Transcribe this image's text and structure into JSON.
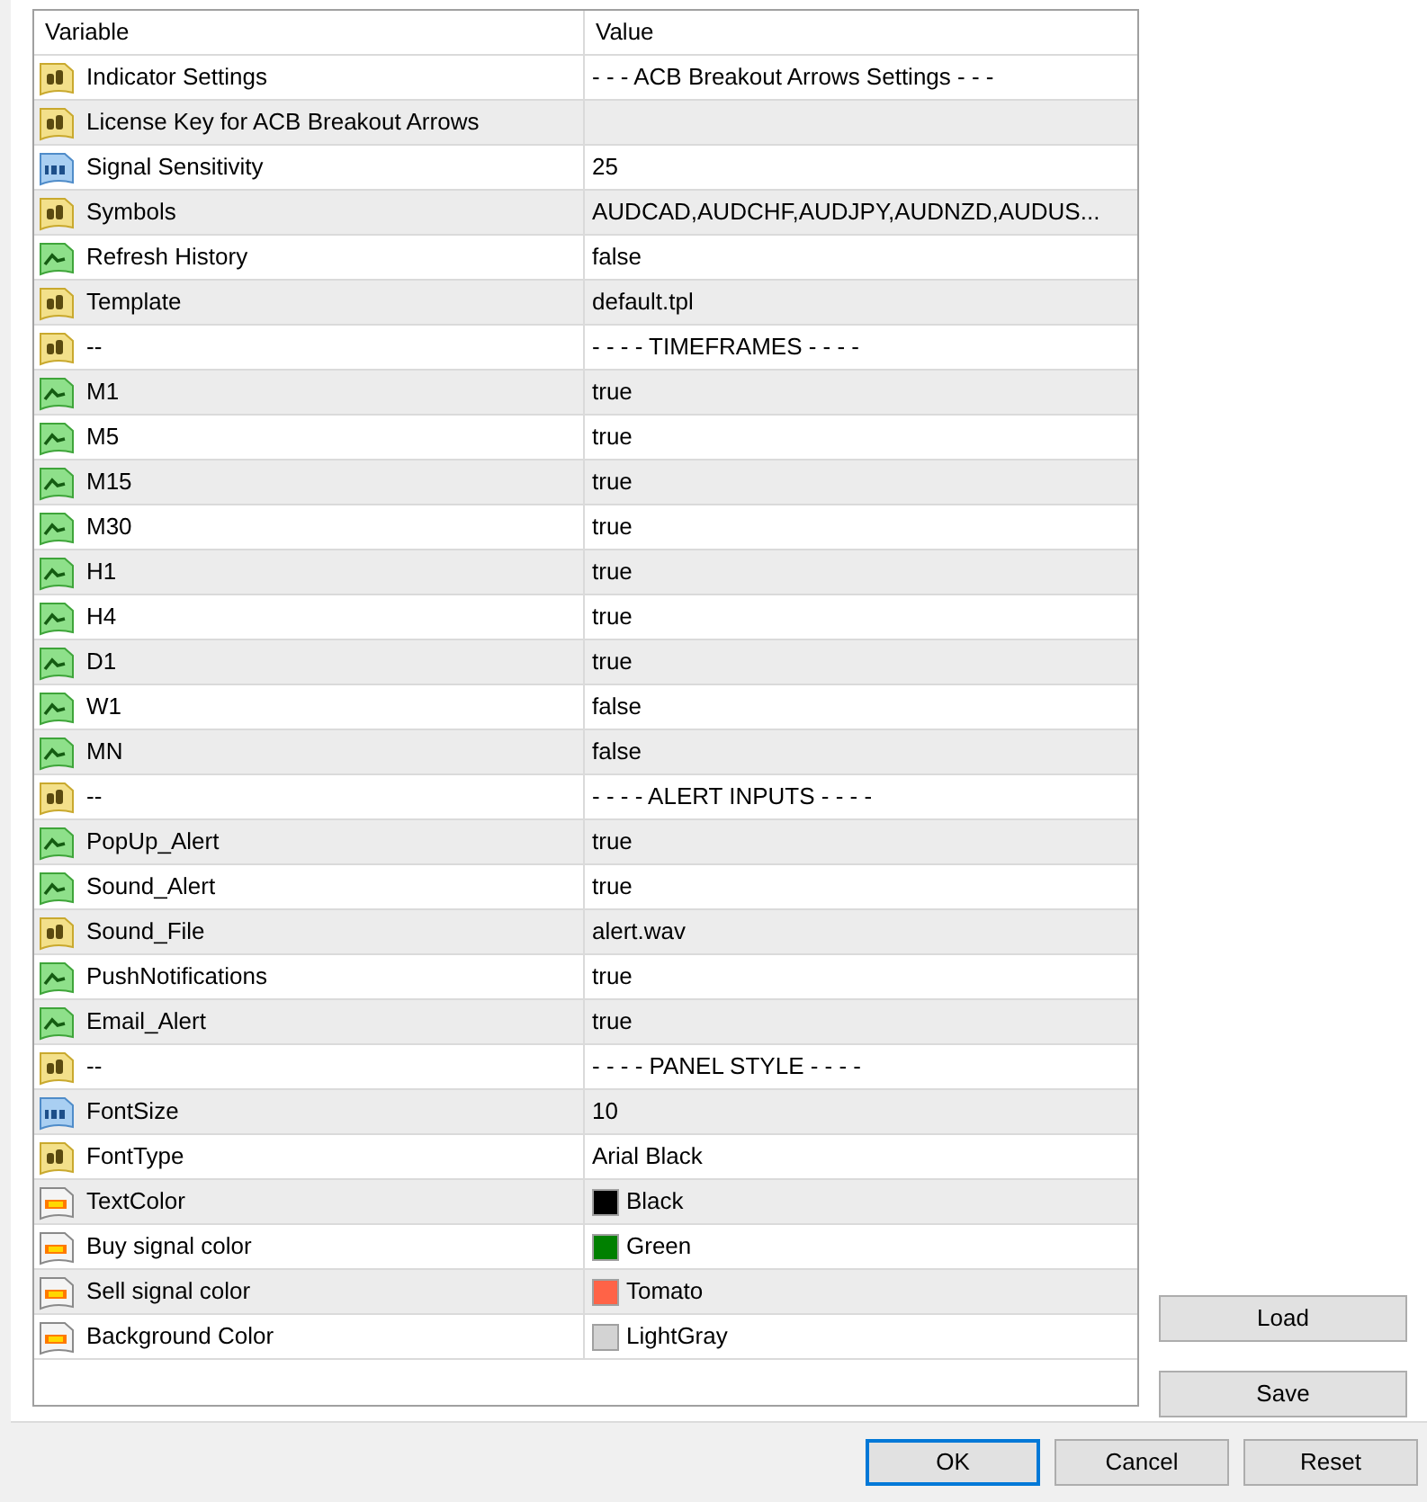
{
  "table": {
    "columns": [
      "Variable",
      "Value"
    ],
    "rows": [
      {
        "kind": "string",
        "variable": "Indicator Settings",
        "value": "- - - ACB Breakout Arrows Settings - - -"
      },
      {
        "kind": "string",
        "variable": "License Key for ACB Breakout Arrows"
      },
      {
        "kind": "int",
        "variable": "Signal Sensitivity",
        "value": "25"
      },
      {
        "kind": "string",
        "variable": "Symbols",
        "value": "AUDCAD,AUDCHF,AUDJPY,AUDNZD,AUDUS..."
      },
      {
        "kind": "bool",
        "variable": "Refresh History",
        "value": "false"
      },
      {
        "kind": "string",
        "variable": "Template",
        "value": "default.tpl"
      },
      {
        "kind": "string",
        "variable": "--",
        "value": "- - - - TIMEFRAMES - - - -"
      },
      {
        "kind": "bool",
        "variable": "M1",
        "value": "true"
      },
      {
        "kind": "bool",
        "variable": "M5",
        "value": "true"
      },
      {
        "kind": "bool",
        "variable": "M15",
        "value": "true"
      },
      {
        "kind": "bool",
        "variable": "M30",
        "value": "true"
      },
      {
        "kind": "bool",
        "variable": "H1",
        "value": "true"
      },
      {
        "kind": "bool",
        "variable": "H4",
        "value": "true"
      },
      {
        "kind": "bool",
        "variable": "D1",
        "value": "true"
      },
      {
        "kind": "bool",
        "variable": "W1",
        "value": "false"
      },
      {
        "kind": "bool",
        "variable": "MN",
        "value": "false"
      },
      {
        "kind": "string",
        "variable": "--",
        "value": "- - - - ALERT INPUTS - - - -"
      },
      {
        "kind": "bool",
        "variable": "PopUp_Alert",
        "value": "true"
      },
      {
        "kind": "bool",
        "variable": "Sound_Alert",
        "value": "true"
      },
      {
        "kind": "string",
        "variable": "Sound_File",
        "value": "alert.wav"
      },
      {
        "kind": "bool",
        "variable": "PushNotifications",
        "value": "true"
      },
      {
        "kind": "bool",
        "variable": "Email_Alert",
        "value": "true"
      },
      {
        "kind": "string",
        "variable": "--",
        "value": "- - - - PANEL STYLE - - - -"
      },
      {
        "kind": "int",
        "variable": "FontSize",
        "value": "10"
      },
      {
        "kind": "string",
        "variable": "FontType",
        "value": "Arial Black"
      },
      {
        "kind": "color",
        "variable": "TextColor",
        "value": "Black",
        "color": "#000000"
      },
      {
        "kind": "color",
        "variable": "Buy signal color",
        "value": "Green",
        "color": "#008000"
      },
      {
        "kind": "color",
        "variable": "Sell signal color",
        "value": "Tomato",
        "color": "#ff6347"
      },
      {
        "kind": "color",
        "variable": "Background Color",
        "value": "LightGray",
        "color": "#d3d3d3"
      }
    ]
  },
  "side_buttons": [
    "Load",
    "Save"
  ],
  "footer_buttons": [
    {
      "label": "OK",
      "selected": true
    },
    {
      "label": "Cancel",
      "selected": false
    },
    {
      "label": "Reset",
      "selected": false
    }
  ]
}
